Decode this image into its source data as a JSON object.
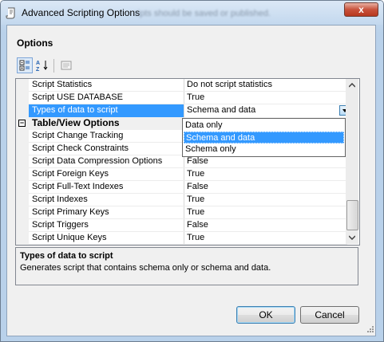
{
  "window": {
    "title": "Advanced Scripting Options",
    "background_title_text": "ripts should be saved or published.",
    "close_label": "x"
  },
  "options_label": "Options",
  "toolbar": {
    "categorized_icon": "categorized-view-icon",
    "alphabetical_icon": "alphabetical-sort-icon",
    "property_pages_icon": "property-pages-icon"
  },
  "properties": {
    "rows": [
      {
        "name": "Script Statistics",
        "value": "Do not script statistics"
      },
      {
        "name": "Script USE DATABASE",
        "value": "True"
      },
      {
        "name": "Types of data to script",
        "value": "Schema and data"
      }
    ],
    "category": "Table/View Options",
    "category_rows": [
      {
        "name": "Script Change Tracking",
        "value": ""
      },
      {
        "name": "Script Check Constraints",
        "value": ""
      },
      {
        "name": "Script Data Compression Options",
        "value": "False"
      },
      {
        "name": "Script Foreign Keys",
        "value": "True"
      },
      {
        "name": "Script Full-Text Indexes",
        "value": "False"
      },
      {
        "name": "Script Indexes",
        "value": "True"
      },
      {
        "name": "Script Primary Keys",
        "value": "True"
      },
      {
        "name": "Script Triggers",
        "value": "False"
      },
      {
        "name": "Script Unique Keys",
        "value": "True"
      }
    ]
  },
  "dropdown": {
    "options": [
      "Data only",
      "Schema and data",
      "Schema only"
    ],
    "selected": "Schema and data"
  },
  "description": {
    "title": "Types of data to script",
    "text": "Generates script that contains schema only or schema and data."
  },
  "buttons": {
    "ok": "OK",
    "cancel": "Cancel"
  },
  "colors": {
    "selection": "#3399ff",
    "window_frame": "#b9d1ea",
    "close_button": "#c8523c"
  }
}
